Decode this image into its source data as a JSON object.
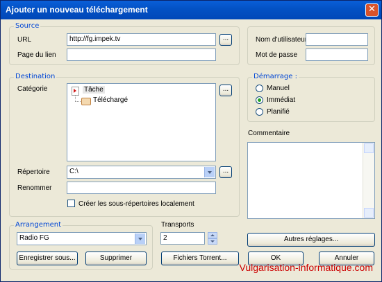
{
  "window": {
    "title": "Ajouter un nouveau téléchargement",
    "close": "✕"
  },
  "source": {
    "group_label": "Source",
    "url_label": "URL",
    "url_value": "http://fg.impek.tv",
    "url_browse": "...",
    "referer_label": "Page du lien",
    "referer_value": ""
  },
  "auth": {
    "user_label": "Nom d'utilisateur",
    "pass_label": "Mot de passe",
    "user_value": "",
    "pass_value": ""
  },
  "destination": {
    "group_label": "Destination",
    "category_label": "Catégorie",
    "category_browse": "...",
    "tree": [
      {
        "label": "Tâche",
        "level": 0
      },
      {
        "label": "Téléchargé",
        "level": 1
      }
    ],
    "directory_label": "Répertoire",
    "directory_value": "C:\\",
    "directory_browse": "...",
    "rename_label": "Renommer",
    "rename_value": "",
    "create_subdirs_label": "Créer les sous-répertoires localement",
    "create_subdirs_checked": false
  },
  "start": {
    "group_label": "Démarrage :",
    "options": [
      "Manuel",
      "Immédiat",
      "Planifié"
    ],
    "selected": "Immédiat"
  },
  "comment": {
    "label": "Commentaire",
    "value": ""
  },
  "arrangement": {
    "group_label": "Arrangement",
    "value": "Radio FG",
    "save_button": "Enregistrer sous...",
    "delete_button": "Supprimer"
  },
  "transports": {
    "label": "Transports",
    "value": "2"
  },
  "buttons": {
    "torrent": "Fichiers Torrent...",
    "other_settings": "Autres réglages...",
    "ok": "OK",
    "cancel": "Annuler"
  },
  "watermark": "Vulgarisation-informatique.com"
}
